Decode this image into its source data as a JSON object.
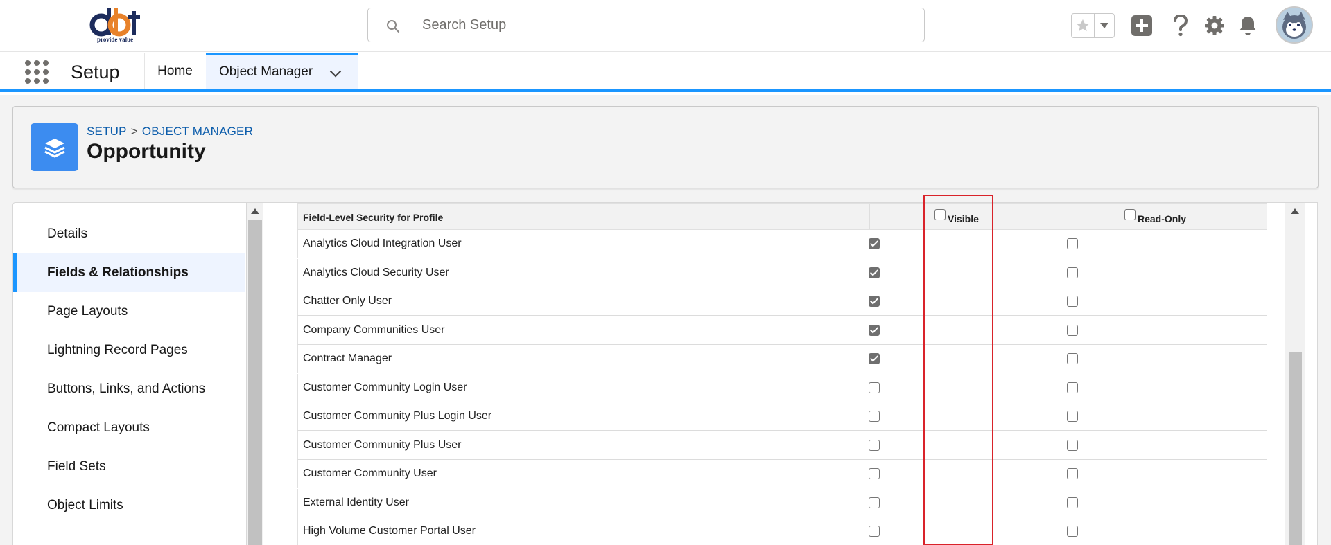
{
  "header": {
    "logo_text": "dbt",
    "logo_tagline": "provide value",
    "search_placeholder": "Search Setup",
    "icons": [
      "star-icon",
      "chevron-down-icon",
      "add-icon",
      "help-icon",
      "setup-gear-icon",
      "notification-bell-icon",
      "user-avatar"
    ]
  },
  "nav": {
    "app_name": "Setup",
    "tabs": [
      {
        "label": "Home"
      },
      {
        "label": "Object Manager"
      }
    ]
  },
  "object_header": {
    "breadcrumb": [
      "SETUP",
      "OBJECT MANAGER"
    ],
    "breadcrumb_separator": ">",
    "title": "Opportunity"
  },
  "sidebar": {
    "items": [
      {
        "label": "Details"
      },
      {
        "label": "Fields & Relationships"
      },
      {
        "label": "Page Layouts"
      },
      {
        "label": "Lightning Record Pages"
      },
      {
        "label": "Buttons, Links, and Actions"
      },
      {
        "label": "Compact Layouts"
      },
      {
        "label": "Field Sets"
      },
      {
        "label": "Object Limits"
      }
    ]
  },
  "fls_table": {
    "header_field": "Field-Level Security for Profile",
    "header_visible": "Visible",
    "header_readonly": "Read-Only",
    "header_visible_checked": false,
    "header_readonly_checked": false,
    "rows": [
      {
        "profile": "Analytics Cloud Integration User",
        "visible": true,
        "read_only": false
      },
      {
        "profile": "Analytics Cloud Security User",
        "visible": true,
        "read_only": false
      },
      {
        "profile": "Chatter Only User",
        "visible": true,
        "read_only": false
      },
      {
        "profile": "Company Communities User",
        "visible": true,
        "read_only": false
      },
      {
        "profile": "Contract Manager",
        "visible": true,
        "read_only": false
      },
      {
        "profile": "Customer Community Login User",
        "visible": false,
        "read_only": false
      },
      {
        "profile": "Customer Community Plus Login User",
        "visible": false,
        "read_only": false
      },
      {
        "profile": "Customer Community Plus User",
        "visible": false,
        "read_only": false
      },
      {
        "profile": "Customer Community User",
        "visible": false,
        "read_only": false
      },
      {
        "profile": "External Identity User",
        "visible": false,
        "read_only": false
      },
      {
        "profile": "High Volume Customer Portal User",
        "visible": false,
        "read_only": false
      }
    ]
  },
  "colors": {
    "brand_blue": "#1b96ff",
    "link_blue": "#0b5cab",
    "object_icon": "#3c8cf0",
    "highlight_red": "#d9232a",
    "checkbox_checked": "#6f6f6f"
  }
}
